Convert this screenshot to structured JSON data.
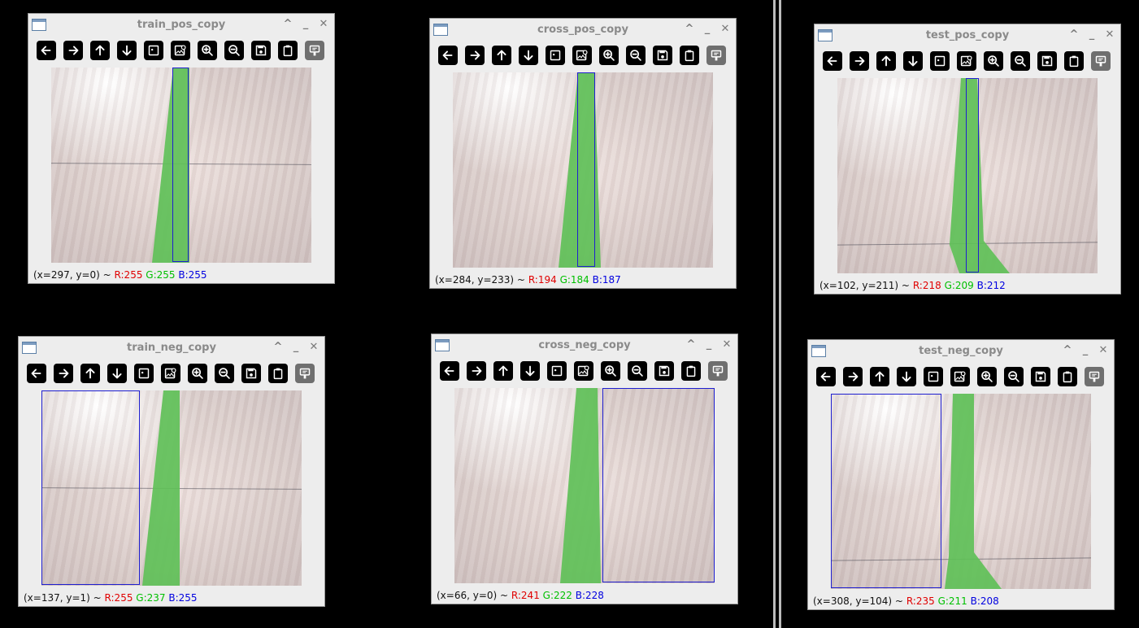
{
  "windows": [
    {
      "title": "train_pos_copy",
      "coords": "(x=297, y=0) ~",
      "r": "R:255",
      "g": "G:255",
      "b": "B:255"
    },
    {
      "title": "cross_pos_copy",
      "coords": "(x=284, y=233) ~",
      "r": "R:194",
      "g": "G:184",
      "b": "B:187"
    },
    {
      "title": "test_pos_copy",
      "coords": "(x=102, y=211) ~",
      "r": "R:218",
      "g": "G:209",
      "b": "B:212"
    },
    {
      "title": "train_neg_copy",
      "coords": "(x=137, y=1) ~",
      "r": "R:255",
      "g": "G:237",
      "b": "B:255"
    },
    {
      "title": "cross_neg_copy",
      "coords": "(x=66, y=0) ~",
      "r": "R:241",
      "g": "G:222",
      "b": "B:228"
    },
    {
      "title": "test_neg_copy",
      "coords": "(x=308, y=104) ~",
      "r": "R:235",
      "g": "G:211",
      "b": "B:208"
    }
  ],
  "title_buttons": {
    "maximize": "^",
    "minimize": "_",
    "close": "✕"
  },
  "toolbar_icons": [
    "pan-left-icon",
    "pan-right-icon",
    "pan-up-icon",
    "pan-down-icon",
    "zoom-fit-icon",
    "zoom-image-icon",
    "zoom-in-icon",
    "zoom-out-icon",
    "save-icon",
    "copy-clipboard-icon",
    "properties-icon"
  ],
  "colors": {
    "tape_green": "#5fc058",
    "bbox_blue": "#1f1fd0",
    "r_text": "#e00000",
    "g_text": "#00c000",
    "b_text": "#0000e0"
  }
}
